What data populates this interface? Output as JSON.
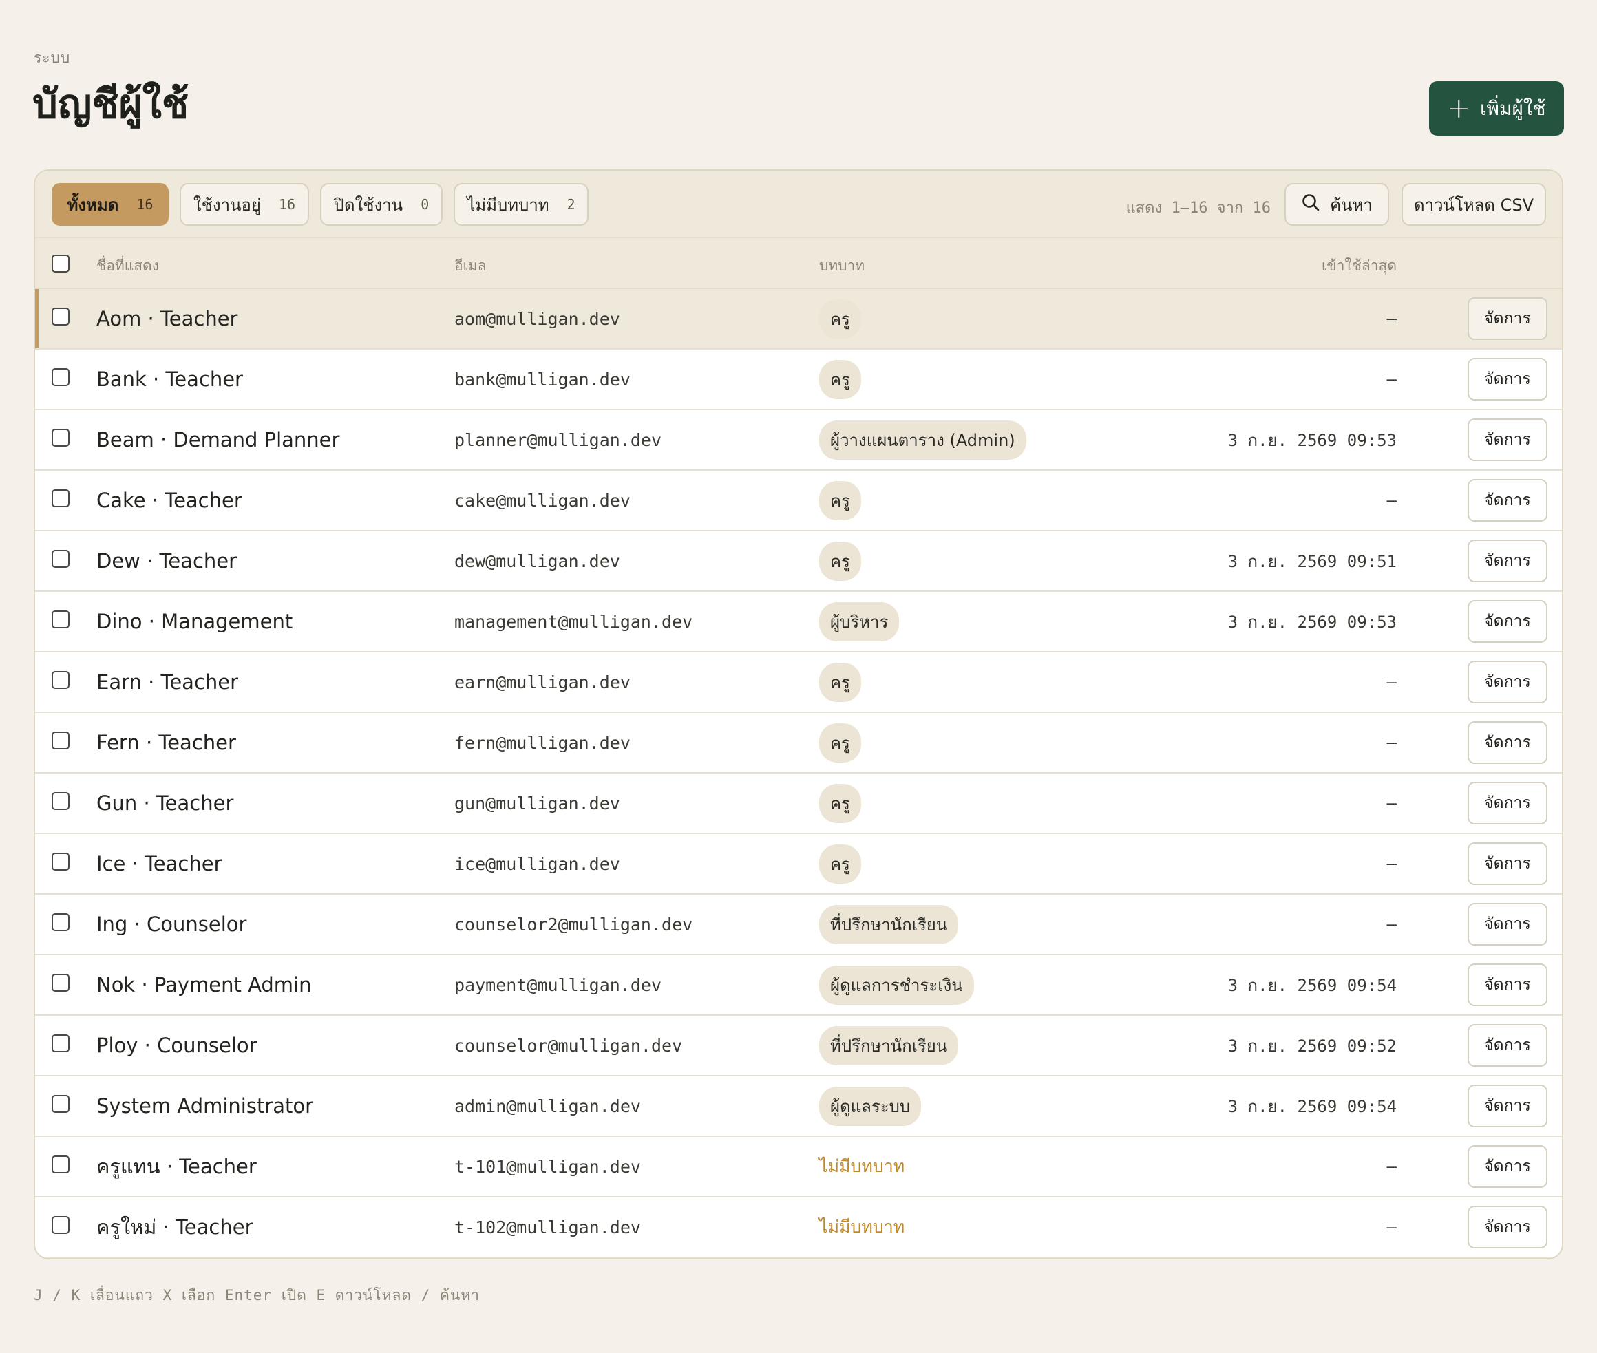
{
  "header": {
    "eyebrow": "ระบบ",
    "title": "บัญชีผู้ใช้",
    "add_button": "เพิ่มผู้ใช้"
  },
  "tabs": [
    {
      "label": "ทั้งหมด",
      "count": "16",
      "active": true
    },
    {
      "label": "ใช้งานอยู่",
      "count": "16",
      "active": false
    },
    {
      "label": "ปิดใช้งาน",
      "count": "0",
      "active": false
    },
    {
      "label": "ไม่มีบทบาท",
      "count": "2",
      "active": false
    }
  ],
  "toolbar": {
    "showing": "แสดง 1–16 จาก 16",
    "search_label": "ค้นหา",
    "csv_label": "ดาวน์โหลด CSV"
  },
  "table": {
    "headers": {
      "name": "ชื่อที่แสดง",
      "email": "อีเมล",
      "role": "บทบาท",
      "last_login": "เข้าใช้ล่าสุด"
    },
    "manage_label": "จัดการ",
    "rows": [
      {
        "name": "Aom · Teacher",
        "email": "aom@mulligan.dev",
        "role": "ครู",
        "no_role": false,
        "last": "–"
      },
      {
        "name": "Bank · Teacher",
        "email": "bank@mulligan.dev",
        "role": "ครู",
        "no_role": false,
        "last": "–"
      },
      {
        "name": "Beam · Demand Planner",
        "email": "planner@mulligan.dev",
        "role": "ผู้วางแผนตาราง (Admin)",
        "no_role": false,
        "last": "3 ก.ย. 2569 09:53"
      },
      {
        "name": "Cake · Teacher",
        "email": "cake@mulligan.dev",
        "role": "ครู",
        "no_role": false,
        "last": "–"
      },
      {
        "name": "Dew · Teacher",
        "email": "dew@mulligan.dev",
        "role": "ครู",
        "no_role": false,
        "last": "3 ก.ย. 2569 09:51"
      },
      {
        "name": "Dino · Management",
        "email": "management@mulligan.dev",
        "role": "ผู้บริหาร",
        "no_role": false,
        "last": "3 ก.ย. 2569 09:53"
      },
      {
        "name": "Earn · Teacher",
        "email": "earn@mulligan.dev",
        "role": "ครู",
        "no_role": false,
        "last": "–"
      },
      {
        "name": "Fern · Teacher",
        "email": "fern@mulligan.dev",
        "role": "ครู",
        "no_role": false,
        "last": "–"
      },
      {
        "name": "Gun · Teacher",
        "email": "gun@mulligan.dev",
        "role": "ครู",
        "no_role": false,
        "last": "–"
      },
      {
        "name": "Ice · Teacher",
        "email": "ice@mulligan.dev",
        "role": "ครู",
        "no_role": false,
        "last": "–"
      },
      {
        "name": "Ing · Counselor",
        "email": "counselor2@mulligan.dev",
        "role": "ที่ปรึกษานักเรียน",
        "no_role": false,
        "last": "–"
      },
      {
        "name": "Nok · Payment Admin",
        "email": "payment@mulligan.dev",
        "role": "ผู้ดูแลการชำระเงิน",
        "no_role": false,
        "last": "3 ก.ย. 2569 09:54"
      },
      {
        "name": "Ploy · Counselor",
        "email": "counselor@mulligan.dev",
        "role": "ที่ปรึกษานักเรียน",
        "no_role": false,
        "last": "3 ก.ย. 2569 09:52"
      },
      {
        "name": "System Administrator",
        "email": "admin@mulligan.dev",
        "role": "ผู้ดูแลระบบ",
        "no_role": false,
        "last": "3 ก.ย. 2569 09:54"
      },
      {
        "name": "ครูแทน · Teacher",
        "email": "t-101@mulligan.dev",
        "role": "ไม่มีบทบาท",
        "no_role": true,
        "last": "–"
      },
      {
        "name": "ครูใหม่ · Teacher",
        "email": "t-102@mulligan.dev",
        "role": "ไม่มีบทบาท",
        "no_role": true,
        "last": "–"
      }
    ]
  },
  "footer": {
    "shortcuts": "J / K เลื่อนแถว  X เลือก  Enter เปิด  E ดาวน์โหลด  / ค้นหา"
  },
  "colors": {
    "accent": "#c49a60",
    "primary_button": "#245440",
    "no_role_text": "#c08a2a",
    "background": "#f5f1ea"
  },
  "icons": {
    "add": "plus-icon",
    "search": "search-icon"
  }
}
